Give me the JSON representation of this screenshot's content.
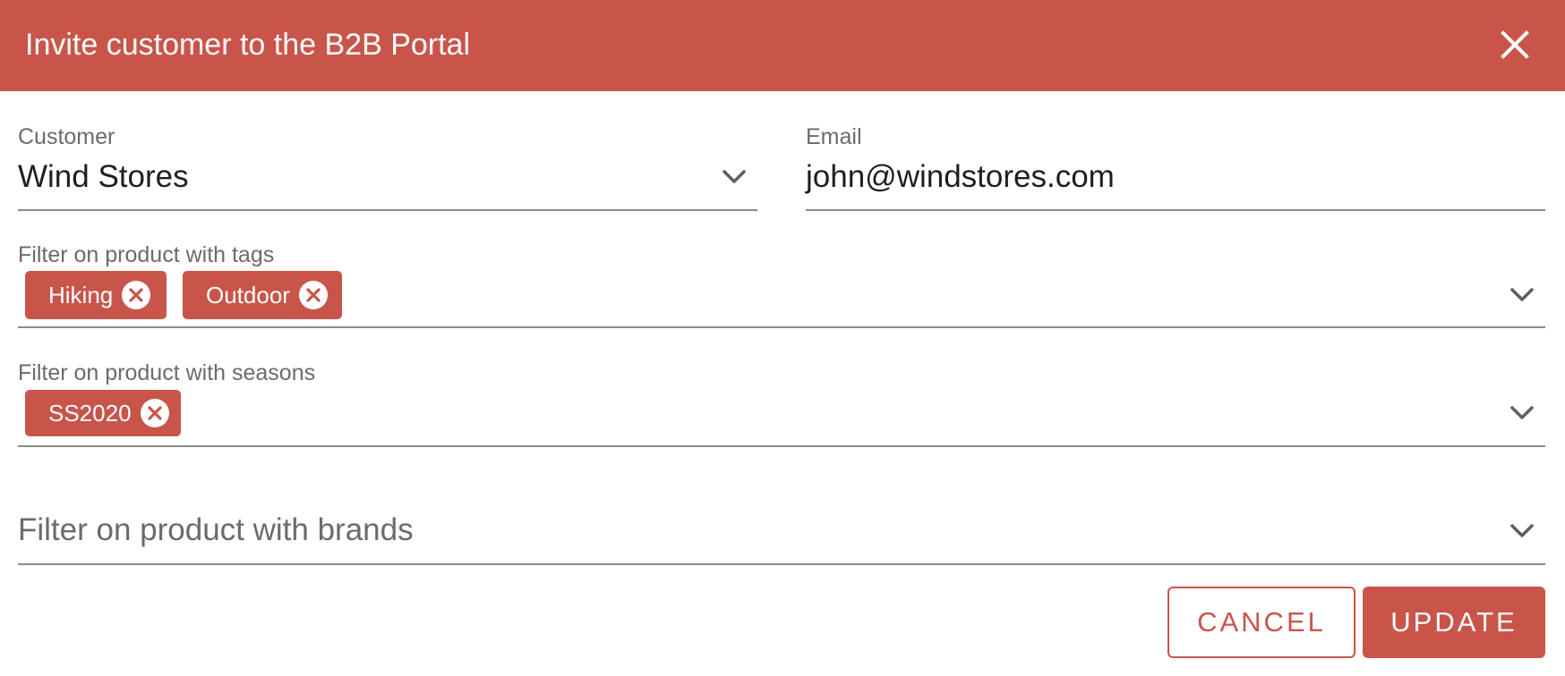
{
  "dialog": {
    "title": "Invite customer to the B2B Portal",
    "close_icon": "close-icon"
  },
  "customer": {
    "label": "Customer",
    "value": "Wind Stores",
    "icon": "chevron-down-icon"
  },
  "email": {
    "label": "Email",
    "value": "john@windstores.com"
  },
  "tags": {
    "label": "Filter on product with tags",
    "chips": [
      {
        "label": "Hiking"
      },
      {
        "label": "Outdoor"
      }
    ],
    "icon": "chevron-down-icon"
  },
  "seasons": {
    "label": "Filter on product with seasons",
    "chips": [
      {
        "label": "SS2020"
      }
    ],
    "icon": "chevron-down-icon"
  },
  "brands": {
    "placeholder": "Filter on product with brands",
    "icon": "chevron-down-icon"
  },
  "actions": {
    "cancel_label": "CANCEL",
    "update_label": "UPDATE"
  },
  "colors": {
    "accent": "#c9554a",
    "text": "#1f1f1f",
    "muted": "#6b6b6b",
    "divider": "#8a8a8a"
  }
}
